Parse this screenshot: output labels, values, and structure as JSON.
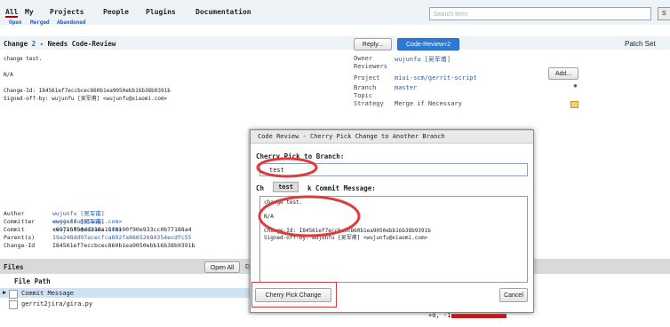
{
  "nav": {
    "tabs": [
      "All",
      "My",
      "Projects",
      "People",
      "Plugins",
      "Documentation"
    ],
    "subtabs": [
      "Open",
      "Merged",
      "Abandoned"
    ],
    "search_placeholder": "Search term",
    "search_button": "S"
  },
  "change": {
    "title_prefix": "Change",
    "number": "2",
    "title_suffix": "- Needs Code-Review",
    "reply_button": "Reply...",
    "code_review_button": "Code-Review+2",
    "patch_sets": "Patch Set",
    "message_lines": [
      "change test.",
      "",
      "N/A",
      "",
      "Change-Id: I84561ef7eccbcec860b1ea9050ebb16b38b9391b",
      "Signed-off-by: wujunfu [吴军甫] <wujunfu@xiaomi.com>"
    ]
  },
  "info": {
    "owner_label": "Owner",
    "owner_value": "wujunfu [吴军甫]",
    "reviewers_label": "Reviewers",
    "add_button": "Add...",
    "project_label": "Project",
    "project_value": "miui-scm/gerrit-script",
    "branch_label": "Branch",
    "branch_value": "master",
    "topic_label": "Topic",
    "strategy_label": "Strategy",
    "strategy_value": "Merge if Necessary"
  },
  "commit": {
    "author_label": "Author",
    "author_value": "wujunfu [吴军甫] <wujunfu@xiaomi.com>",
    "committer_label": "Committer",
    "committer_value": "wujunfu [吴军甫] <wujunfu@xiaomi.com>",
    "commit_label": "Commit",
    "commit_value": "c69715054dd216a15f0190f90e933cc0b77188a4",
    "parent_label": "Parent(s)",
    "parent_value": "19a248dd97acecfca892fa86652684354ecdfc55",
    "changeid_label": "Change-Id",
    "changeid_value": "I84561ef7eccbcec860b1ea9050ebb16b38b9391b"
  },
  "files": {
    "header": "Files",
    "open_all": "Open All",
    "diff": "Diff",
    "path_header": "File Path",
    "rows": [
      "Commit Message",
      "gerrit2jira/gira.py"
    ],
    "stats": "+0, -1"
  },
  "dialog": {
    "title": "Code Review - Cherry Pick Change to Another Branch",
    "branch_label": "Cherry Pick to Branch:",
    "branch_value": "test",
    "suggestion": "test",
    "msg_label_left": "Ch",
    "msg_label_right": "k Commit Message:",
    "message": "change test.\n\nN/A\n\nChange-Id: I84561ef7eccbcec860b1ea9050ebb16b38b9391b\nSigned-off-by: wujunfu [吴军甫] <wujunfu@xiaomi.com>",
    "cherry_pick_button": "Cherry Pick Change",
    "cancel_button": "Cancel"
  },
  "colors": {
    "accent": "#2c7ad6",
    "annotation": "#e03b3b",
    "header_bg": "#eef3f8"
  }
}
